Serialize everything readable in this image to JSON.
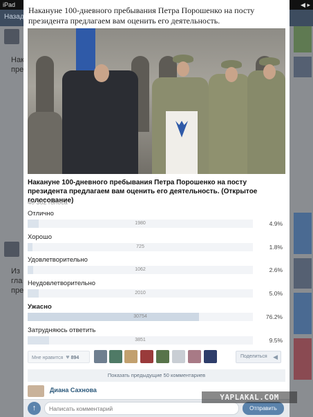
{
  "statusbar": {
    "device": "iPad",
    "icons": "◀ ▸"
  },
  "navbar": {
    "back_label": "Назад"
  },
  "feed": {
    "left_snippets": [
      "Нак",
      "пре",
      "Из",
      "гла",
      "пре"
    ]
  },
  "post": {
    "text": "Накануне 100-дневного пребывания Петра Порошенко на посту президента предлагаем вам оценить его деятельность."
  },
  "poll": {
    "question": "Накануне 100-дневного пребывания Петра Порошенко на посту президента предлагаем вам оценить его деятельность. (Открытое голосование)",
    "total_votes_label": "40 382 голоса",
    "options": [
      {
        "label": "Отлично",
        "count": "1980",
        "percent": "4.9%",
        "fill": 0.049
      },
      {
        "label": "Хорошо",
        "count": "725",
        "percent": "1.8%",
        "fill": 0.018
      },
      {
        "label": "Удовлетворительно",
        "count": "1062",
        "percent": "2.6%",
        "fill": 0.026
      },
      {
        "label": "Неудовлетворительно",
        "count": "2010",
        "percent": "5.0%",
        "fill": 0.05
      },
      {
        "label": "Ужасно",
        "count": "30754",
        "percent": "76.2%",
        "fill": 0.762
      },
      {
        "label": "Затрудняюсь ответить",
        "count": "3851",
        "percent": "9.5%",
        "fill": 0.095
      }
    ]
  },
  "likes": {
    "like_label": "Мне нравится",
    "like_count": "894",
    "share_label": "Поделиться"
  },
  "comments": {
    "show_previous_label": "Показать предыдущие 50 комментариев",
    "first_author": "Диана Сахнова"
  },
  "compose": {
    "placeholder": "Написать комментарий",
    "send_label": "Отправить"
  },
  "watermark": "YAPLAKAL.COM",
  "colors": {
    "accent": "#5b83ac",
    "link": "#2b587a",
    "bar_fill": "#dbe3ec"
  }
}
